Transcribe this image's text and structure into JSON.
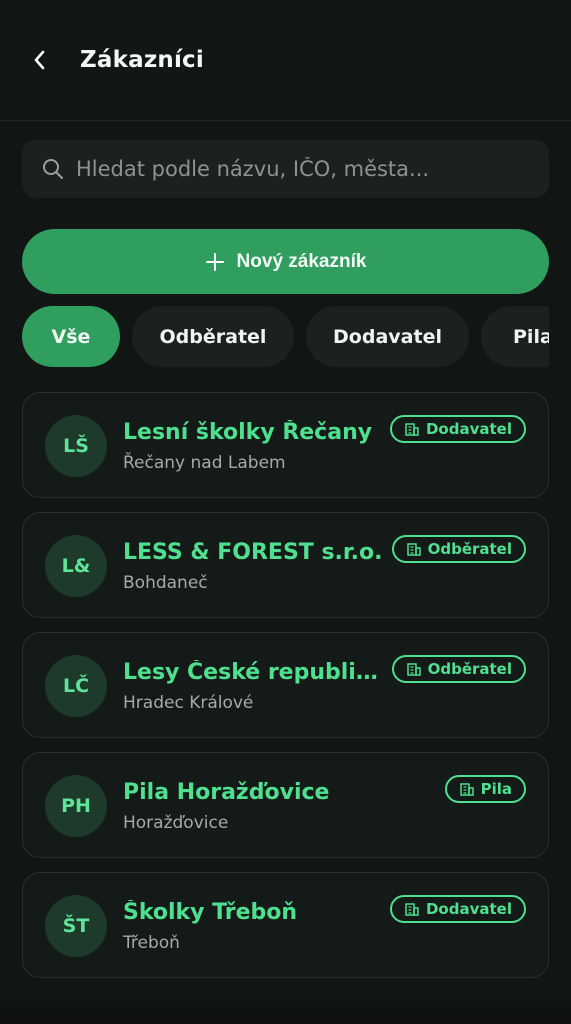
{
  "header": {
    "title": "Zákazníci",
    "back_icon": "chevron-left-icon"
  },
  "search": {
    "placeholder": "Hledat podle názvu, IČO, města...",
    "value": "",
    "icon": "search-icon"
  },
  "new_button": {
    "label": "Nový zákazník",
    "icon": "plus-icon"
  },
  "filters": [
    {
      "label": "Vše",
      "active": true
    },
    {
      "label": "Odběratel",
      "active": false
    },
    {
      "label": "Dodavatel",
      "active": false
    },
    {
      "label": "Pila",
      "active": false
    }
  ],
  "customers": [
    {
      "initials": "LŠ",
      "name": "Lesní školky Řečany",
      "city": "Řečany nad Labem",
      "type": "Dodavatel"
    },
    {
      "initials": "L&",
      "name": "LESS & FOREST s.r.o.",
      "city": "Bohdaneč",
      "type": "Odběratel"
    },
    {
      "initials": "LČ",
      "name": "Lesy České republiky, s.p.",
      "city": "Hradec Králové",
      "type": "Odběratel"
    },
    {
      "initials": "PH",
      "name": "Pila Horažďovice",
      "city": "Horažďovice",
      "type": "Pila"
    },
    {
      "initials": "ŠT",
      "name": "Školky Třeboň",
      "city": "Třeboň",
      "type": "Dodavatel"
    }
  ],
  "colors": {
    "accent": "#2f9e5e",
    "accent_text": "#4ee08f",
    "background": "#111513",
    "card": "#141a17"
  }
}
